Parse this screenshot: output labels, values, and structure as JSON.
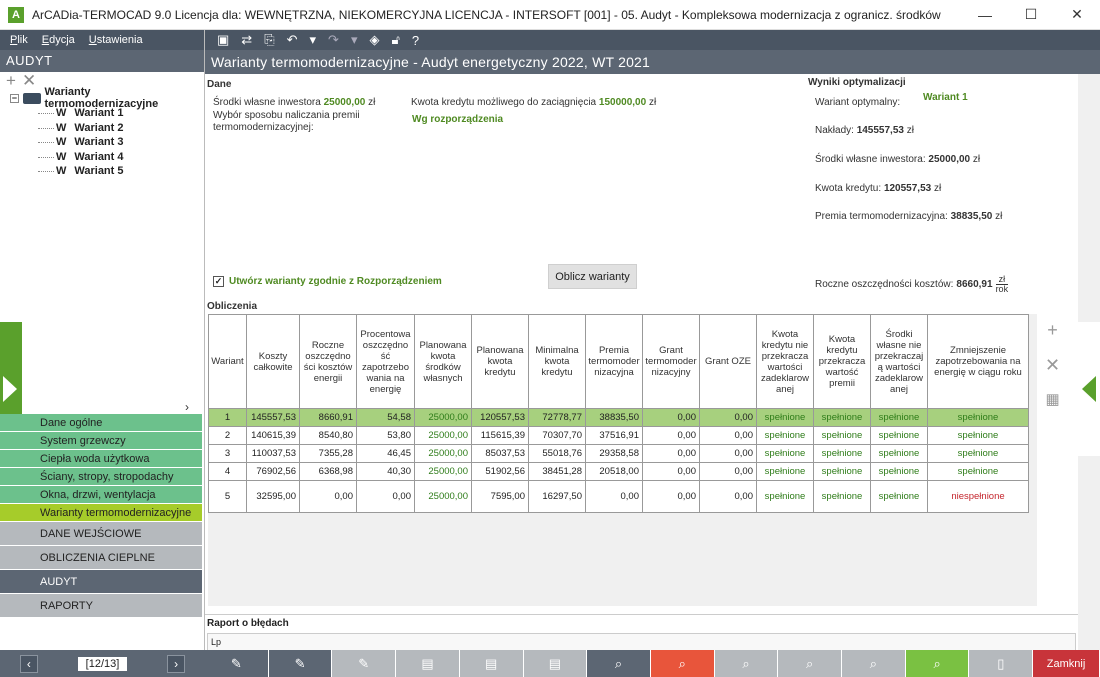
{
  "window": {
    "title": "ArCADia-TERMOCAD 9.0 Licencja dla: WEWNĘTRZNA, NIEKOMERCYJNA LICENCJA - INTERSOFT [001] - 05. Audyt - Kompleksowa modernizacja z ogranicz. środków",
    "minimize": "—",
    "maximize": "☐",
    "close": "✕"
  },
  "menu": {
    "file": "Plik",
    "edit": "Edycja",
    "settings": "Ustawienia"
  },
  "left": {
    "header": "AUDYT",
    "tree": {
      "root": "Warianty termomodernizacyjne",
      "items": [
        "Wariant 1",
        "Wariant 2",
        "Wariant 3",
        "Wariant 4",
        "Wariant 5"
      ]
    },
    "nav_items": [
      "Dane ogólne",
      "System grzewczy",
      "Ciepła woda użytkowa",
      "Ściany, stropy, stropodachy",
      "Okna, drzwi, wentylacja",
      "Warianty termomodernizacyjne"
    ],
    "nav_groups": [
      "DANE WEJŚCIOWE",
      "OBLICZENIA CIEPLNE",
      "AUDYT",
      "RAPORTY"
    ],
    "pager": "[12/13]"
  },
  "panel_title": "Warianty termomodernizacyjne - Audyt energetyczny 2022, WT 2021",
  "dane": {
    "title": "Dane",
    "own_funds_label": "Środki własne inwestora",
    "own_funds_value": "25000,00",
    "own_funds_unit": "zł",
    "credit_label": "Kwota kredytu możliwego do zaciągnięcia",
    "credit_value": "150000,00",
    "credit_unit": "zł",
    "premium_method_label_1": "Wybór sposobu naliczania premii",
    "premium_method_label_2": "termomodernizacyjnej:",
    "premium_method_value": "Wg rozporządzenia",
    "checkbox_label": "Utwórz warianty zgodnie z Rozporządzeniem",
    "checkbox_state": "✓",
    "calc_button": "Oblicz warianty"
  },
  "wyniki": {
    "title": "Wyniki optymalizacji",
    "optimal_label": "Wariant optymalny:",
    "optimal_value": "Wariant 1",
    "costs_label": "Nakłady:",
    "costs_value": "145557,53",
    "own_label": "Środki własne inwestora:",
    "own_value": "25000,00",
    "credit_label": "Kwota kredytu:",
    "credit_value": "120557,53",
    "premium_label": "Premia termomodernizacyjna:",
    "premium_value": "38835,50",
    "unit": "zł",
    "savings_label": "Roczne oszczędności kosztów:",
    "savings_value": "8660,91",
    "savings_unit_top": "zł",
    "savings_unit_bottom": "rok"
  },
  "obliczenia": {
    "title": "Obliczenia",
    "headers": [
      "Wariant",
      "Koszty całkowite",
      "Roczne oszczędności kosztów energii",
      "Procentowa oszczędność zapotrzebowania na energię",
      "Planowana kwota środków własnych",
      "Planowana kwota kredytu",
      "Minimalna kwota kredytu",
      "Premia termomodernizacyjna",
      "Grant termomodernizacyjny",
      "Grant OZE",
      "Kwota kredytu nie przekracza wartości zadeklarowanej",
      "Kwota kredytu przekracza wartość premii",
      "Środki własne nie przekraczają wartości zadeklarowanej",
      "Zmniejszenie zapotrzebowania na energię w ciągu roku"
    ],
    "headers_display": [
      "Wariant",
      "Koszty\ncałkowite",
      "Roczne\noszczędno\nści kosztów\nenergii",
      "Procentowa\noszczędno\nść\nzapotrzebo\nwania na\nenergię",
      "Planowana\nkwota\nśrodków\nwłasnych",
      "Planowana\nkwota\nkredytu",
      "Minimalna\nkwota\nkredytu",
      "Premia\ntermomoder\nnizacyjna",
      "Grant\ntermomoder\nnizacyjny",
      "Grant OZE",
      "Kwota\nkredytu nie\nprzekracza\nwartości\nzadeklarow\nanej",
      "Kwota\nkredytu\nprzekracza\nwartość\npremii",
      "Środki\nwłasne nie\nprzekraczaj\ną wartości\nzadeklarow\nanej",
      "Zmniejszenie\nzapotrzebowania na\nenergię w ciągu roku"
    ],
    "rows": [
      [
        "1",
        "145557,53",
        "8660,91",
        "54,58",
        "25000,00",
        "120557,53",
        "72778,77",
        "38835,50",
        "0,00",
        "0,00",
        "spełnione",
        "spełnione",
        "spełnione",
        "spełnione"
      ],
      [
        "2",
        "140615,39",
        "8540,80",
        "53,80",
        "25000,00",
        "115615,39",
        "70307,70",
        "37516,91",
        "0,00",
        "0,00",
        "spełnione",
        "spełnione",
        "spełnione",
        "spełnione"
      ],
      [
        "3",
        "110037,53",
        "7355,28",
        "46,45",
        "25000,00",
        "85037,53",
        "55018,76",
        "29358,58",
        "0,00",
        "0,00",
        "spełnione",
        "spełnione",
        "spełnione",
        "spełnione"
      ],
      [
        "4",
        "76902,56",
        "6368,98",
        "40,30",
        "25000,00",
        "51902,56",
        "38451,28",
        "20518,00",
        "0,00",
        "0,00",
        "spełnione",
        "spełnione",
        "spełnione",
        "spełnione"
      ],
      [
        "5",
        "32595,00",
        "0,00",
        "0,00",
        "25000,00",
        "7595,00",
        "16297,50",
        "0,00",
        "0,00",
        "0,00",
        "spełnione",
        "spełnione",
        "spełnione",
        "niespełnione"
      ]
    ]
  },
  "raport": {
    "title": "Raport o błędach",
    "col_lp": "Lp"
  },
  "bottom": {
    "close": "Zamknij"
  },
  "colors": {
    "accent_green": "#5aa02c",
    "selected_row": "#a7d07e",
    "active_nav": "#a6cc2a",
    "nav_green": "#6cc18c",
    "close_red": "#c8343a"
  }
}
